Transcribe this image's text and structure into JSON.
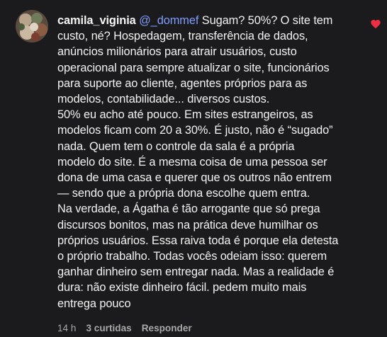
{
  "comment": {
    "username": "camila_viginia",
    "mention": "@_dommef",
    "lines": [
      "Sugam? 50%? O site tem",
      "custo, né? Hospedagem, transferência de dados,",
      "anúncios milionários para atrair usuários, custo",
      "operacional para sempre atualizar o site, funcionários",
      "para suporte ao cliente, agentes próprios para as",
      "modelos, contabilidade... diversos custos.",
      "50% eu acho até pouco. Em sites estrangeiros, as",
      "modelos ficam com 20 a 30%. É justo, não é “sugado”",
      "nada. Quem tem o controle da sala é a própria",
      "modelo do site. É a mesma coisa de uma pessoa ser",
      "dona de uma casa e querer que os outros não entrem",
      "— sendo que a própria dona escolhe quem entra.",
      "Na verdade, a Ágatha é tão arrogante que só prega",
      "discursos bonitos, mas na prática deve humilhar os",
      "próprios usuários. Essa raiva toda é porque ela detesta",
      "o próprio trabalho. Todas vocês odeiam isso: querem",
      "ganhar dinheiro sem entregar nada. Mas a realidade é",
      "dura: não existe dinheiro fácil. pedem muito mais",
      "entrega pouco"
    ]
  },
  "footer": {
    "time": "14 h",
    "likes": "3 curtidas",
    "reply": "Responder"
  },
  "icons": {
    "like": "heart-icon",
    "avatar": "avatar"
  },
  "colors": {
    "background": "#1b1b1d",
    "mention": "#7f9cff",
    "heart": "#ed2f44",
    "secondary_text": "#a8a8a8"
  }
}
